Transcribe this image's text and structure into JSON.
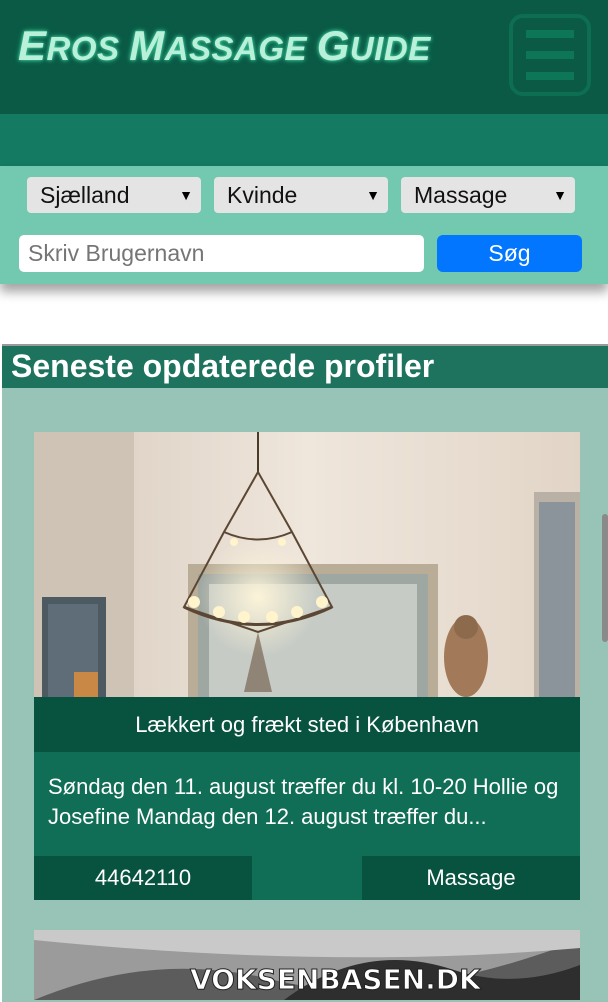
{
  "header": {
    "logo_parts": [
      "E",
      "ROS ",
      "M",
      "ASSAGE ",
      "G",
      "UIDE"
    ],
    "logo_text": "Eros Massage Guide"
  },
  "search": {
    "region_value": "Sjælland",
    "gender_value": "Kvinde",
    "category_value": "Massage",
    "username_placeholder": "Skriv Brugernavn",
    "submit_label": "Søg"
  },
  "section": {
    "title": "Seneste opdaterede profiler"
  },
  "profiles": [
    {
      "title": "Lækkert og frækt sted i København",
      "description": "Søndag den 11. august træffer du kl. 10-20 Hollie og Josefine Mandag den 12. august træffer du...",
      "phone": "44642110",
      "category": "Massage"
    },
    {
      "watermark": "VOKSENBASEN.DK"
    }
  ],
  "icons": {
    "menu": "hamburger-menu-icon",
    "dropdown": "triangle-down-icon"
  },
  "colors": {
    "header": "#0a5a45",
    "search_bg": "#72c9b0",
    "search_button": "#0276ff",
    "card": "#0f6e55"
  }
}
